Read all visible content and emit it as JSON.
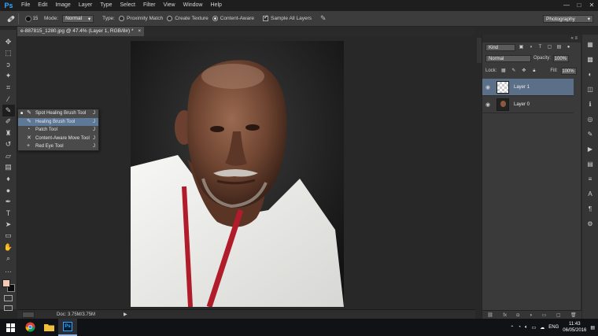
{
  "app": {
    "logo": "Ps",
    "accent": "#31a8ff"
  },
  "menu": [
    "File",
    "Edit",
    "Image",
    "Layer",
    "Type",
    "Select",
    "Filter",
    "View",
    "Window",
    "Help"
  ],
  "window_controls": [
    "—",
    "□",
    "✕"
  ],
  "options": {
    "brush_size": "15",
    "mode_label": "Mode:",
    "mode_value": "Normal",
    "type_label": "Type:",
    "type_options": [
      {
        "label": "Proximity Match",
        "selected": false
      },
      {
        "label": "Create Texture",
        "selected": false
      },
      {
        "label": "Content-Aware",
        "selected": true
      }
    ],
    "sample_all_layers": {
      "label": "Sample All Layers",
      "checked": true
    },
    "workspace": "Photography"
  },
  "document": {
    "tab_title": "e-887815_1280.jpg @ 47.4% (Layer 1, RGB/8#) *",
    "tab_close": "×"
  },
  "status": {
    "doc": "Doc: 3.75M/3.75M",
    "arrow": "▶"
  },
  "flyout": {
    "items": [
      {
        "label": "Spot Healing Brush Tool",
        "key": "J",
        "current": true,
        "highlighted": false,
        "icon": "spot-healing-icon"
      },
      {
        "label": "Healing Brush Tool",
        "key": "J",
        "current": false,
        "highlighted": true,
        "icon": "healing-brush-icon"
      },
      {
        "label": "Patch Tool",
        "key": "J",
        "current": false,
        "highlighted": false,
        "icon": "patch-icon"
      },
      {
        "label": "Content-Aware Move Tool",
        "key": "J",
        "current": false,
        "highlighted": false,
        "icon": "content-aware-move-icon"
      },
      {
        "label": "Red Eye Tool",
        "key": "J",
        "current": false,
        "highlighted": false,
        "icon": "red-eye-icon"
      }
    ]
  },
  "layers_panel": {
    "header_icons": "«  ≡",
    "kind": "Kind",
    "blend_mode": "Normal",
    "opacity_label": "Opacity:",
    "opacity_value": "100%",
    "lock_label": "Lock:",
    "fill_label": "Fill:",
    "fill_value": "100%",
    "layers": [
      {
        "name": "Layer 1",
        "selected": true,
        "thumb": "transparent"
      },
      {
        "name": "Layer 0",
        "selected": false,
        "thumb": "photo"
      }
    ],
    "footer_icons": [
      "link-icon",
      "fx-icon",
      "mask-icon",
      "adjustment-icon",
      "folder-icon",
      "new-layer-icon",
      "trash-icon"
    ]
  },
  "taskbar": {
    "apps": [
      {
        "name": "chrome-icon",
        "active": false
      },
      {
        "name": "folder-icon",
        "active": false
      },
      {
        "name": "photoshop-icon",
        "active": true,
        "label": "Ps"
      }
    ],
    "language": "ENG",
    "time": "11:43",
    "date": "06/05/2016"
  },
  "colors": {
    "foreground": "#f0cbb8",
    "background": "#0b0b0b",
    "selection": "#5c6f88"
  }
}
